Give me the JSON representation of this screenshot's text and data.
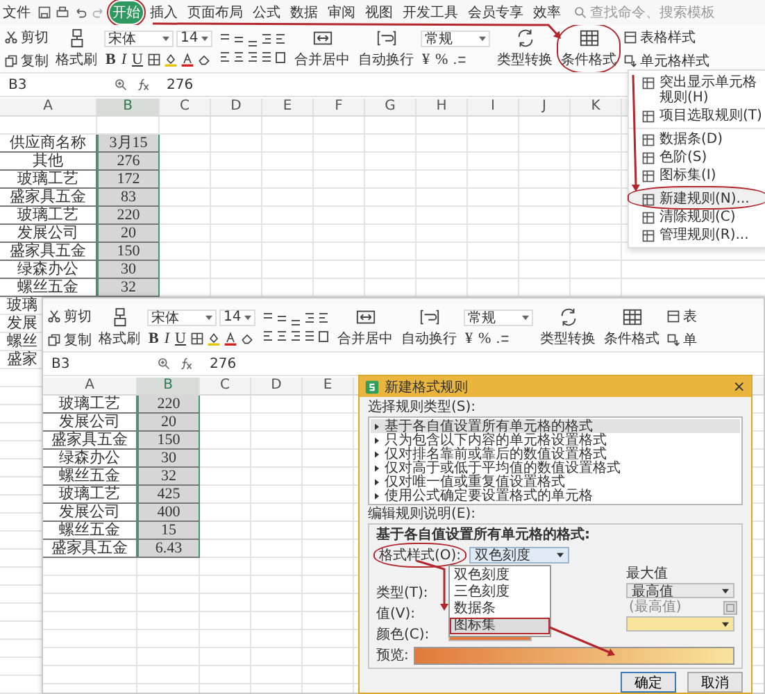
{
  "back_window": {
    "menu_bar": {
      "file": "文件",
      "tabs": [
        {
          "label": "开始",
          "selected": true,
          "circled": true
        },
        {
          "label": "插入",
          "selected": false,
          "circled": false
        },
        {
          "label": "页面布局",
          "selected": false,
          "circled": false
        },
        {
          "label": "公式",
          "selected": false,
          "circled": false
        },
        {
          "label": "数据",
          "selected": false,
          "circled": false
        },
        {
          "label": "审阅",
          "selected": false,
          "circled": false
        },
        {
          "label": "视图",
          "selected": false,
          "circled": false
        },
        {
          "label": "开发工具",
          "selected": false,
          "circled": false
        },
        {
          "label": "会员专享",
          "selected": false,
          "circled": false
        },
        {
          "label": "效率",
          "selected": false,
          "circled": false
        }
      ],
      "search": {
        "placeholder": "查找命令、搜索模板"
      }
    },
    "ribbon": {
      "clipboard": [
        "剪切",
        "复制"
      ],
      "format_painter": "格式刷",
      "font_name": "宋体",
      "font_size": "14",
      "format_buttons": [
        "B",
        "I",
        "U"
      ],
      "merge": "合并居中",
      "wrap": "自动换行",
      "number_format": "常规",
      "number_buttons": [
        "¥",
        "%"
      ],
      "convert": "类型转换",
      "conditional": {
        "label": "条件格式",
        "circled": true
      },
      "styles": [
        "表格样式",
        "单元格样式"
      ]
    },
    "formula_bar": {
      "cell_ref": "B3",
      "formula": "276"
    },
    "sheet": {
      "columns": [
        {
          "label": "A",
          "selected": false
        },
        {
          "label": "B",
          "selected": true
        },
        {
          "label": "C",
          "selected": false
        },
        {
          "label": "D",
          "selected": false
        },
        {
          "label": "E",
          "selected": false
        },
        {
          "label": "F",
          "selected": false
        },
        {
          "label": "G",
          "selected": false
        },
        {
          "label": "H",
          "selected": false
        },
        {
          "label": "I",
          "selected": false
        },
        {
          "label": "J",
          "selected": false
        },
        {
          "label": "K",
          "selected": false
        }
      ],
      "rows": [
        {
          "a": "供应商名称",
          "b": "3月15"
        },
        {
          "a": "其他",
          "b": "276"
        },
        {
          "a": "玻璃工艺",
          "b": "172"
        },
        {
          "a": "盛家具五金",
          "b": "83"
        },
        {
          "a": "玻璃工艺",
          "b": "220"
        },
        {
          "a": "发展公司",
          "b": "20"
        },
        {
          "a": "盛家具五金",
          "b": "150"
        },
        {
          "a": "绿森办公",
          "b": "30"
        },
        {
          "a": "螺丝五金",
          "b": "32"
        },
        {
          "a": "玻璃"
        },
        {
          "a": "发展"
        },
        {
          "a": "螺丝"
        },
        {
          "a": "盛家"
        }
      ]
    },
    "conditional_menu": {
      "items": [
        {
          "label": "突出显示单元格规则(H)",
          "circled": false
        },
        {
          "label": "项目选取规则(T)",
          "circled": false
        },
        {
          "label": "数据条(D)",
          "circled": false
        },
        {
          "label": "色阶(S)",
          "circled": false
        },
        {
          "label": "图标集(I)",
          "circled": false
        },
        {
          "label": "新建规则(N)...",
          "circled": true
        },
        {
          "label": "清除规则(C)",
          "circled": false
        },
        {
          "label": "管理规则(R)...",
          "circled": false
        }
      ]
    }
  },
  "front_window": {
    "ribbon": {
      "clipboard": [
        "剪切",
        "复制"
      ],
      "format_painter": "格式刷",
      "font_name": "宋体",
      "font_size": "14",
      "format_buttons": [
        "B",
        "I",
        "U"
      ],
      "merge": "合并居中",
      "wrap": "自动换行",
      "number_format": "常规",
      "number_buttons": [
        "¥",
        "%"
      ],
      "convert": "类型转换",
      "conditional": {
        "label": "条件格式",
        "circled": false
      },
      "styles": [
        "表",
        "单"
      ]
    },
    "formula_bar": {
      "cell_ref": "B3",
      "formula": "276"
    },
    "sheet": {
      "columns": [
        {
          "label": "A",
          "selected": false
        },
        {
          "label": "B",
          "selected": true
        },
        {
          "label": "C",
          "selected": false
        },
        {
          "label": "D",
          "selected": false
        },
        {
          "label": "E",
          "selected": false
        }
      ],
      "rows": [
        {
          "a": "玻璃工艺",
          "b": "220"
        },
        {
          "a": "发展公司",
          "b": "20"
        },
        {
          "a": "盛家具五金",
          "b": "150"
        },
        {
          "a": "绿森办公",
          "b": "30"
        },
        {
          "a": "螺丝五金",
          "b": "32"
        },
        {
          "a": "玻璃工艺",
          "b": "425"
        },
        {
          "a": "发展公司",
          "b": "400"
        },
        {
          "a": "螺丝五金",
          "b": "15"
        },
        {
          "a": "盛家具五金",
          "b": "6.43"
        }
      ]
    }
  },
  "dialog": {
    "title": "新建格式规则",
    "close": "×",
    "rule_type_label": "选择规则类型(S):",
    "rule_types": [
      {
        "label": "基于各自值设置所有单元格的格式",
        "selected": true
      },
      {
        "label": "只为包含以下内容的单元格设置格式",
        "selected": false
      },
      {
        "label": "仅对排名靠前或靠后的数值设置格式",
        "selected": false
      },
      {
        "label": "仅对高于或低于平均值的数值设置格式",
        "selected": false
      },
      {
        "label": "仅对唯一值或重复值设置格式",
        "selected": false
      },
      {
        "label": "使用公式确定要设置格式的单元格",
        "selected": false
      }
    ],
    "description_label": "编辑规则说明(E):",
    "description_heading": "基于各自值设置所有单元格的格式:",
    "format_style": {
      "label": "格式样式(O):",
      "circled": true,
      "value": "双色刻度",
      "options": [
        {
          "label": "双色刻度",
          "highlighted": false
        },
        {
          "label": "三色刻度",
          "highlighted": false
        },
        {
          "label": "数据条",
          "highlighted": false
        },
        {
          "label": "图标集",
          "highlighted": true
        }
      ]
    },
    "min_labels": [
      "类型(T):",
      "值(V):",
      "颜色(C):"
    ],
    "max": {
      "heading": "最大值",
      "type": "最高值",
      "value_placeholder": "(最高值)"
    },
    "preview_label": "预览:",
    "buttons": [
      "确定",
      "取消"
    ]
  }
}
